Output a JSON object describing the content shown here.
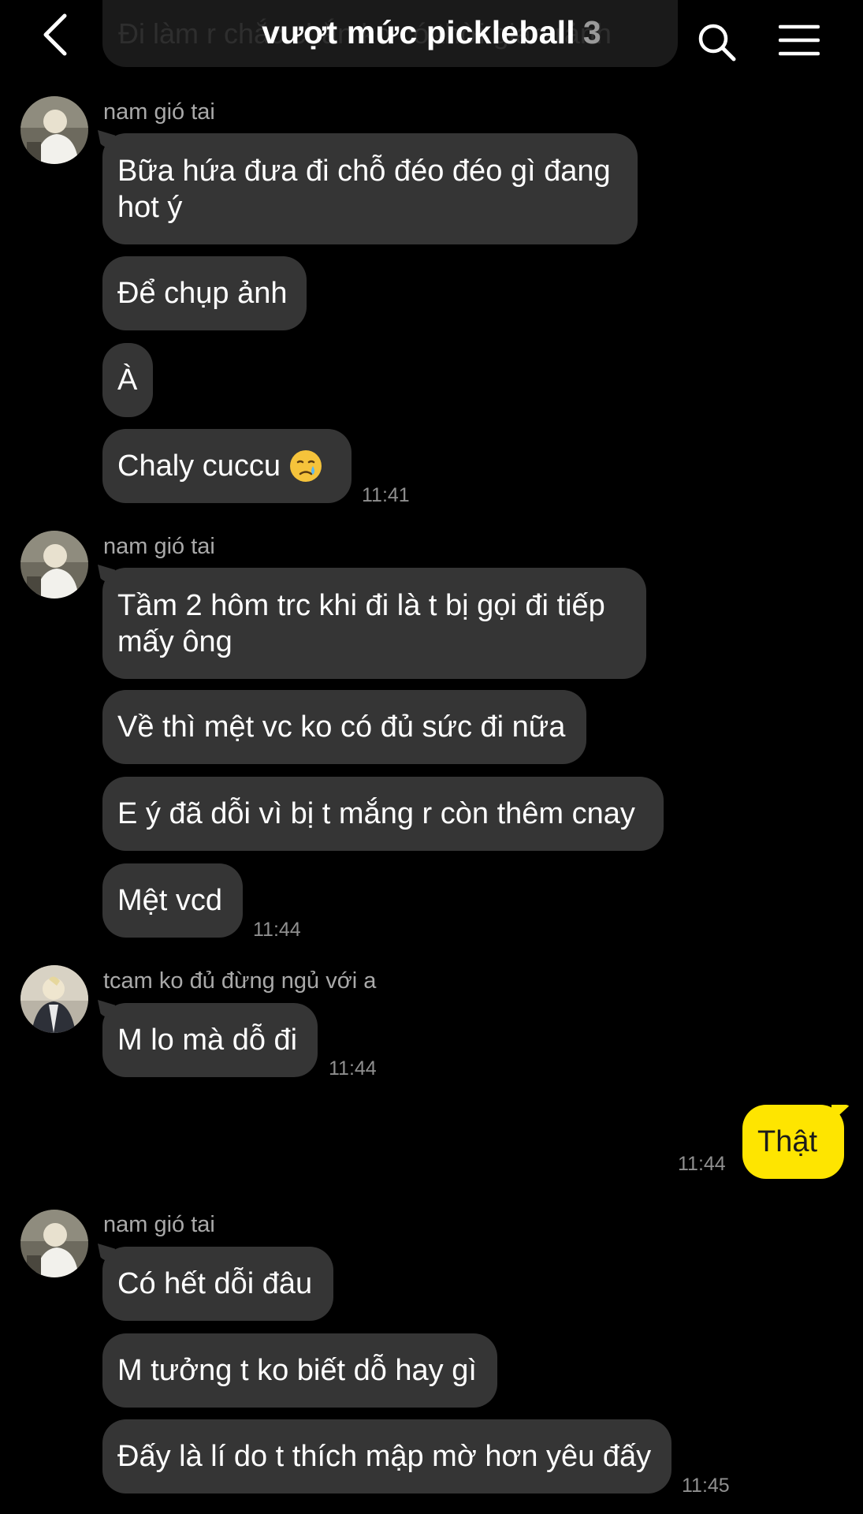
{
  "header": {
    "ghost_preview": "Đi làm r chắc chắn ko có thời gian rảnh",
    "title": "vượt mức pickleball",
    "member_count": "3"
  },
  "groups": [
    {
      "sender": "nam gió tai",
      "messages": [
        "Bữa hứa đưa đi chỗ đéo đéo gì đang hot ý",
        "Để chụp ảnh",
        "À",
        "Chaly cuccu"
      ],
      "emoji": "crying-face",
      "time": "11:41"
    },
    {
      "sender": "nam gió tai",
      "messages": [
        "Tầm 2 hôm trc khi đi là t bị gọi đi tiếp mấy ông",
        "Về thì mệt vc ko có đủ sức đi nữa",
        "E ý đã dỗi vì bị t mắng r còn thêm cnay",
        "Mệt vcd"
      ],
      "time": "11:44"
    },
    {
      "sender": "tcam ko đủ đừng ngủ với a",
      "messages": [
        "M lo mà dỗ đi"
      ],
      "time": "11:44"
    },
    {
      "sender": "me",
      "messages": [
        "Thật"
      ],
      "time": "11:44"
    },
    {
      "sender": "nam gió tai",
      "messages": [
        "Có hết dỗi đâu",
        "M tưởng t ko biết dỗ hay gì",
        "Đấy là lí do t thích mập mờ hơn yêu đấy"
      ],
      "time": "11:45"
    }
  ],
  "colors": {
    "background": "#000000",
    "incoming_bubble": "#353535",
    "outgoing_bubble": "#fee500",
    "timestamp": "#8f8f8f"
  }
}
